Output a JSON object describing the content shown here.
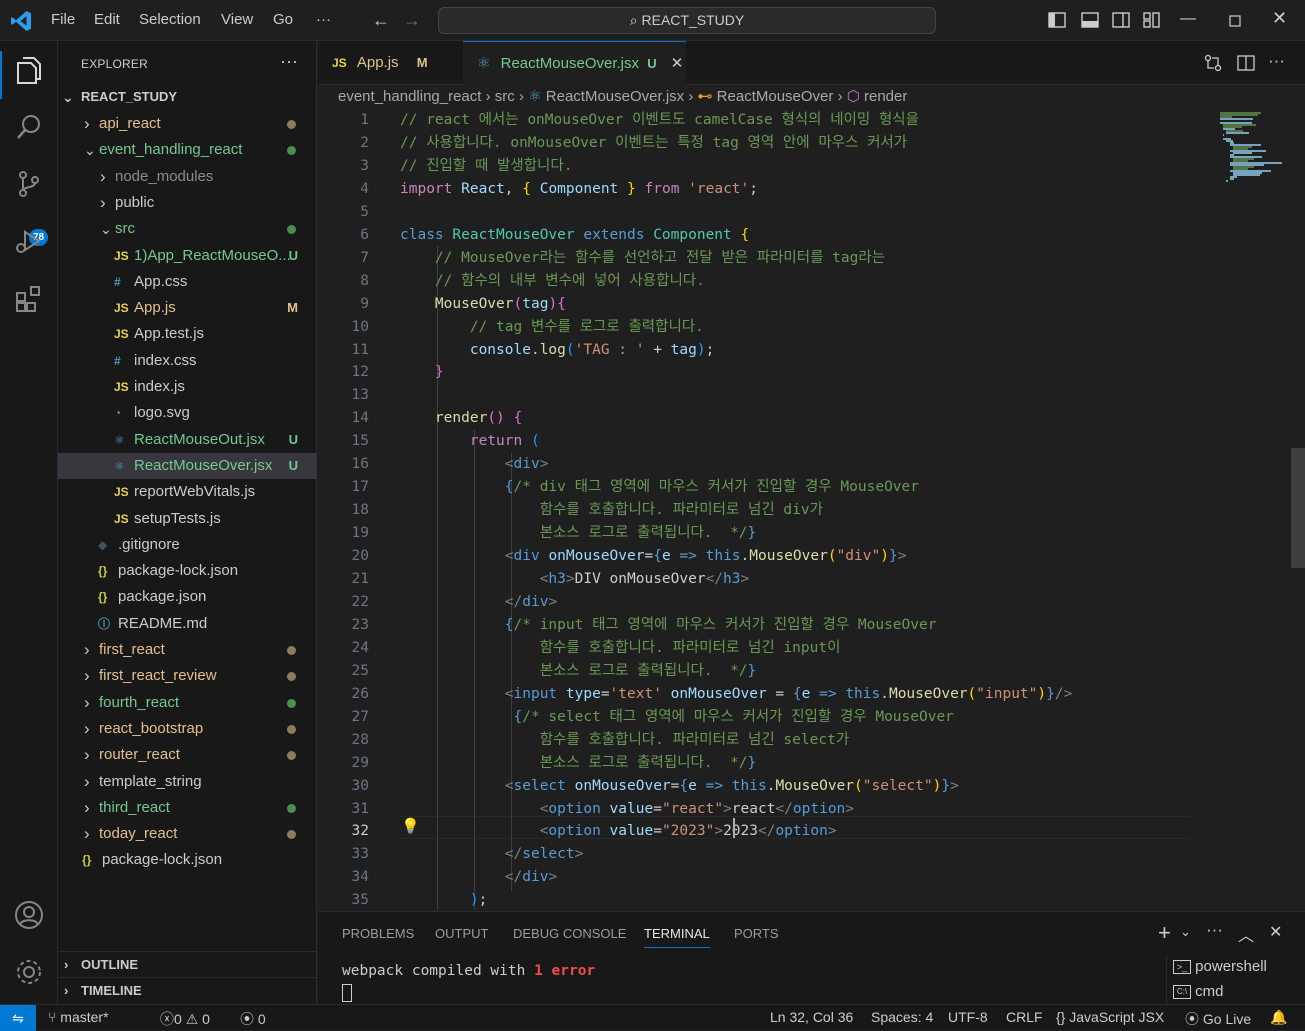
{
  "titlebar": {
    "menus": [
      "File",
      "Edit",
      "Selection",
      "View",
      "Go",
      "···"
    ],
    "search_text": "REACT_STUDY"
  },
  "activity": {
    "source_control_badge": "78"
  },
  "explorer": {
    "title": "EXPLORER",
    "root": "REACT_STUDY",
    "items": [
      {
        "label": "api_react",
        "type": "folder",
        "level": 1,
        "expanded": false,
        "status": "dot",
        "status_color": "#8c7a5a",
        "label_color": "#e2c08d"
      },
      {
        "label": "event_handling_react",
        "type": "folder",
        "level": 1,
        "expanded": true,
        "status": "dot",
        "status_color": "#4a8f4a",
        "label_color": "#73c991"
      },
      {
        "label": "node_modules",
        "type": "folder",
        "level": 2,
        "expanded": false,
        "label_color": "#8b8b8b"
      },
      {
        "label": "public",
        "type": "folder",
        "level": 2,
        "expanded": false,
        "label_color": "#cccccc"
      },
      {
        "label": "src",
        "type": "folder",
        "level": 2,
        "expanded": true,
        "status": "dot",
        "status_color": "#4a8f4a",
        "label_color": "#73c991"
      },
      {
        "label": "1)App_ReactMouseO...",
        "type": "js",
        "level": 3,
        "status": "U",
        "label_color": "#73c991"
      },
      {
        "label": "App.css",
        "type": "css",
        "level": 3,
        "label_color": "#cccccc"
      },
      {
        "label": "App.js",
        "type": "js",
        "level": 3,
        "status": "M",
        "label_color": "#e2c08d"
      },
      {
        "label": "App.test.js",
        "type": "js",
        "level": 3,
        "label_color": "#cccccc"
      },
      {
        "label": "index.css",
        "type": "css",
        "level": 3,
        "label_color": "#cccccc"
      },
      {
        "label": "index.js",
        "type": "js",
        "level": 3,
        "label_color": "#cccccc"
      },
      {
        "label": "logo.svg",
        "type": "svg",
        "level": 3,
        "label_color": "#cccccc"
      },
      {
        "label": "ReactMouseOut.jsx",
        "type": "react",
        "level": 3,
        "status": "U",
        "label_color": "#73c991"
      },
      {
        "label": "ReactMouseOver.jsx",
        "type": "react",
        "level": 3,
        "status": "U",
        "label_color": "#73c991",
        "selected": true
      },
      {
        "label": "reportWebVitals.js",
        "type": "js",
        "level": 3,
        "label_color": "#cccccc"
      },
      {
        "label": "setupTests.js",
        "type": "js",
        "level": 3,
        "label_color": "#cccccc"
      },
      {
        "label": ".gitignore",
        "type": "git",
        "level": 2,
        "label_color": "#cccccc"
      },
      {
        "label": "package-lock.json",
        "type": "json",
        "level": 2,
        "label_color": "#cccccc"
      },
      {
        "label": "package.json",
        "type": "json",
        "level": 2,
        "label_color": "#cccccc"
      },
      {
        "label": "README.md",
        "type": "md",
        "level": 2,
        "label_color": "#cccccc"
      },
      {
        "label": "first_react",
        "type": "folder",
        "level": 1,
        "expanded": false,
        "status": "dot",
        "status_color": "#8c7a5a",
        "label_color": "#e2c08d"
      },
      {
        "label": "first_react_review",
        "type": "folder",
        "level": 1,
        "expanded": false,
        "status": "dot",
        "status_color": "#8c7a5a",
        "label_color": "#e2c08d"
      },
      {
        "label": "fourth_react",
        "type": "folder",
        "level": 1,
        "expanded": false,
        "status": "dot",
        "status_color": "#4a8f4a",
        "label_color": "#73c991"
      },
      {
        "label": "react_bootstrap",
        "type": "folder",
        "level": 1,
        "expanded": false,
        "status": "dot",
        "status_color": "#8c7a5a",
        "label_color": "#e2c08d"
      },
      {
        "label": "router_react",
        "type": "folder",
        "level": 1,
        "expanded": false,
        "status": "dot",
        "status_color": "#8c7a5a",
        "label_color": "#e2c08d"
      },
      {
        "label": "template_string",
        "type": "folder",
        "level": 1,
        "expanded": false,
        "label_color": "#cccccc"
      },
      {
        "label": "third_react",
        "type": "folder",
        "level": 1,
        "expanded": false,
        "status": "dot",
        "status_color": "#4a8f4a",
        "label_color": "#73c991"
      },
      {
        "label": "today_react",
        "type": "folder",
        "level": 1,
        "expanded": false,
        "status": "dot",
        "status_color": "#8c7a5a",
        "label_color": "#e2c08d"
      },
      {
        "label": "package-lock.json",
        "type": "json",
        "level": 1,
        "label_color": "#cccccc"
      }
    ],
    "outline": "OUTLINE",
    "timeline": "TIMELINE"
  },
  "tabs": [
    {
      "icon": "JS",
      "label": "App.js",
      "status": "M",
      "active": false
    },
    {
      "icon": "react",
      "label": "ReactMouseOver.jsx",
      "status": "U",
      "active": true
    }
  ],
  "breadcrumbs": [
    "event_handling_react",
    "src",
    "ReactMouseOver.jsx",
    "ReactMouseOver",
    "render"
  ],
  "editor": {
    "current_line": 32,
    "lines": [
      [
        [
          "// react 에서는 onMouseOver 이벤트도 camelCase 형식의 네이밍 형식을",
          "c-com"
        ]
      ],
      [
        [
          "// 사용합니다. onMouseOver 이벤트는 특정 tag 영역 안에 마우스 커서가",
          "c-com"
        ]
      ],
      [
        [
          "// 진입할 때 발생합니다.",
          "c-com"
        ]
      ],
      [
        [
          "import",
          "c-kw"
        ],
        [
          " ",
          ""
        ],
        [
          "React",
          "c-var"
        ],
        [
          ", ",
          ""
        ],
        [
          "{",
          "c-y"
        ],
        [
          " ",
          ""
        ],
        [
          "Component",
          "c-var"
        ],
        [
          " ",
          ""
        ],
        [
          "}",
          "c-y"
        ],
        [
          " ",
          ""
        ],
        [
          "from",
          "c-kw"
        ],
        [
          " ",
          ""
        ],
        [
          "'react'",
          "c-str"
        ],
        [
          ";",
          ""
        ]
      ],
      [],
      [
        [
          "class",
          "c-bl"
        ],
        [
          " ",
          ""
        ],
        [
          "ReactMouseOver",
          "c-tp"
        ],
        [
          " ",
          ""
        ],
        [
          "extends",
          "c-bl"
        ],
        [
          " ",
          ""
        ],
        [
          "Component",
          "c-tp"
        ],
        [
          " ",
          ""
        ],
        [
          "{",
          "c-y"
        ]
      ],
      [
        [
          "    ",
          ""
        ],
        [
          "// MouseOver라는 함수를 선언하고 전달 받은 파라미터를 tag라는",
          "c-com"
        ]
      ],
      [
        [
          "    ",
          ""
        ],
        [
          "// 함수의 내부 변수에 넣어 사용합니다.",
          "c-com"
        ]
      ],
      [
        [
          "    ",
          ""
        ],
        [
          "MouseOver",
          "c-fn"
        ],
        [
          "(",
          "c-p"
        ],
        [
          "tag",
          "c-var"
        ],
        [
          ")",
          "c-p"
        ],
        [
          "{",
          "c-p"
        ]
      ],
      [
        [
          "        ",
          ""
        ],
        [
          "// tag 변수를 로그로 출력합니다.",
          "c-com"
        ]
      ],
      [
        [
          "        ",
          ""
        ],
        [
          "console",
          "c-var"
        ],
        [
          ".",
          ""
        ],
        [
          "log",
          "c-fn"
        ],
        [
          "(",
          "c-b"
        ],
        [
          "'TAG : '",
          "c-str"
        ],
        [
          " + ",
          ""
        ],
        [
          "tag",
          "c-var"
        ],
        [
          ")",
          "c-b"
        ],
        [
          ";",
          ""
        ]
      ],
      [
        [
          "    ",
          ""
        ],
        [
          "}",
          "c-p"
        ]
      ],
      [],
      [
        [
          "    ",
          ""
        ],
        [
          "render",
          "c-fn"
        ],
        [
          "(",
          "c-p"
        ],
        [
          ")",
          "c-p"
        ],
        [
          " ",
          ""
        ],
        [
          "{",
          "c-p"
        ]
      ],
      [
        [
          "        ",
          ""
        ],
        [
          "return",
          "c-kw"
        ],
        [
          " ",
          ""
        ],
        [
          "(",
          "c-b"
        ]
      ],
      [
        [
          "            ",
          ""
        ],
        [
          "<",
          "c-brk"
        ],
        [
          "div",
          "c-tag"
        ],
        [
          ">",
          "c-brk"
        ]
      ],
      [
        [
          "            ",
          ""
        ],
        [
          "{",
          "c-bl"
        ],
        [
          "/* div 태그 영역에 마우스 커서가 진입할 경우 MouseOver",
          "c-com"
        ]
      ],
      [
        [
          "                ",
          ""
        ],
        [
          "함수를 호출합니다. 파라미터로 넘긴 div가",
          "c-com"
        ]
      ],
      [
        [
          "                ",
          ""
        ],
        [
          "본소스 로그로 출력됩니다.  */",
          "c-com"
        ],
        [
          "}",
          "c-bl"
        ]
      ],
      [
        [
          "            ",
          ""
        ],
        [
          "<",
          "c-brk"
        ],
        [
          "div",
          "c-tag"
        ],
        [
          " ",
          ""
        ],
        [
          "onMouseOver",
          "c-var"
        ],
        [
          "=",
          ""
        ],
        [
          "{",
          "c-bl"
        ],
        [
          "e",
          "c-var"
        ],
        [
          " ",
          ""
        ],
        [
          "=>",
          "c-bl"
        ],
        [
          " ",
          ""
        ],
        [
          "this",
          "c-bl"
        ],
        [
          ".",
          ""
        ],
        [
          "MouseOver",
          "c-fn"
        ],
        [
          "(",
          "c-y"
        ],
        [
          "\"div\"",
          "c-str"
        ],
        [
          ")",
          "c-y"
        ],
        [
          "}",
          "c-bl"
        ],
        [
          ">",
          "c-brk"
        ]
      ],
      [
        [
          "                ",
          ""
        ],
        [
          "<",
          "c-brk"
        ],
        [
          "h3",
          "c-tag"
        ],
        [
          ">",
          "c-brk"
        ],
        [
          "DIV onMouseOver",
          ""
        ],
        [
          "</",
          "c-brk"
        ],
        [
          "h3",
          "c-tag"
        ],
        [
          ">",
          "c-brk"
        ]
      ],
      [
        [
          "            ",
          ""
        ],
        [
          "</",
          "c-brk"
        ],
        [
          "div",
          "c-tag"
        ],
        [
          ">",
          "c-brk"
        ]
      ],
      [
        [
          "            ",
          ""
        ],
        [
          "{",
          "c-bl"
        ],
        [
          "/* input 태그 영역에 마우스 커서가 진입할 경우 MouseOver",
          "c-com"
        ]
      ],
      [
        [
          "                ",
          ""
        ],
        [
          "함수를 호출합니다. 파라미터로 넘긴 input이",
          "c-com"
        ]
      ],
      [
        [
          "                ",
          ""
        ],
        [
          "본소스 로그로 출력됩니다.  */",
          "c-com"
        ],
        [
          "}",
          "c-bl"
        ]
      ],
      [
        [
          "            ",
          ""
        ],
        [
          "<",
          "c-brk"
        ],
        [
          "input",
          "c-tag"
        ],
        [
          " ",
          ""
        ],
        [
          "type",
          "c-var"
        ],
        [
          "=",
          ""
        ],
        [
          "'text'",
          "c-str"
        ],
        [
          " ",
          ""
        ],
        [
          "onMouseOver",
          "c-var"
        ],
        [
          " = ",
          ""
        ],
        [
          "{",
          "c-bl"
        ],
        [
          "e",
          "c-var"
        ],
        [
          " ",
          ""
        ],
        [
          "=>",
          "c-bl"
        ],
        [
          " ",
          ""
        ],
        [
          "this",
          "c-bl"
        ],
        [
          ".",
          ""
        ],
        [
          "MouseOver",
          "c-fn"
        ],
        [
          "(",
          "c-y"
        ],
        [
          "\"input\"",
          "c-str"
        ],
        [
          ")",
          "c-y"
        ],
        [
          "}",
          "c-bl"
        ],
        [
          "/>",
          "c-brk"
        ]
      ],
      [
        [
          "             ",
          ""
        ],
        [
          "{",
          "c-bl"
        ],
        [
          "/* select 태그 영역에 마우스 커서가 진입할 경우 MouseOver",
          "c-com"
        ]
      ],
      [
        [
          "                ",
          ""
        ],
        [
          "함수를 호출합니다. 파라미터로 넘긴 select가",
          "c-com"
        ]
      ],
      [
        [
          "                ",
          ""
        ],
        [
          "본소스 로그로 출력됩니다.  */",
          "c-com"
        ],
        [
          "}",
          "c-bl"
        ]
      ],
      [
        [
          "            ",
          ""
        ],
        [
          "<",
          "c-brk"
        ],
        [
          "select",
          "c-tag"
        ],
        [
          " ",
          ""
        ],
        [
          "onMouseOver",
          "c-var"
        ],
        [
          "=",
          ""
        ],
        [
          "{",
          "c-bl"
        ],
        [
          "e",
          "c-var"
        ],
        [
          " ",
          ""
        ],
        [
          "=>",
          "c-bl"
        ],
        [
          " ",
          ""
        ],
        [
          "this",
          "c-bl"
        ],
        [
          ".",
          ""
        ],
        [
          "MouseOver",
          "c-fn"
        ],
        [
          "(",
          "c-y"
        ],
        [
          "\"select\"",
          "c-str"
        ],
        [
          ")",
          "c-y"
        ],
        [
          "}",
          "c-bl"
        ],
        [
          ">",
          "c-brk"
        ]
      ],
      [
        [
          "                ",
          ""
        ],
        [
          "<",
          "c-brk"
        ],
        [
          "option",
          "c-tag"
        ],
        [
          " ",
          ""
        ],
        [
          "value",
          "c-var"
        ],
        [
          "=",
          ""
        ],
        [
          "\"react\"",
          "c-str"
        ],
        [
          ">",
          "c-brk"
        ],
        [
          "react",
          ""
        ],
        [
          "</",
          "c-brk"
        ],
        [
          "option",
          "c-tag"
        ],
        [
          ">",
          "c-brk"
        ]
      ],
      [
        [
          "                ",
          ""
        ],
        [
          "<",
          "c-brk"
        ],
        [
          "option",
          "c-tag"
        ],
        [
          " ",
          ""
        ],
        [
          "value",
          "c-var"
        ],
        [
          "=",
          ""
        ],
        [
          "\"2023\"",
          "c-str"
        ],
        [
          ">",
          "c-brk"
        ],
        [
          "2023",
          ""
        ],
        [
          "</",
          "c-brk"
        ],
        [
          "option",
          "c-tag"
        ],
        [
          ">",
          "c-brk"
        ]
      ],
      [
        [
          "            ",
          ""
        ],
        [
          "</",
          "c-brk"
        ],
        [
          "select",
          "c-tag"
        ],
        [
          ">",
          "c-brk"
        ]
      ],
      [
        [
          "            ",
          ""
        ],
        [
          "</",
          "c-brk"
        ],
        [
          "div",
          "c-tag"
        ],
        [
          ">",
          "c-brk"
        ]
      ],
      [
        [
          "        ",
          ""
        ],
        [
          ")",
          "c-b"
        ],
        [
          ";",
          ""
        ]
      ]
    ]
  },
  "panel": {
    "tabs": [
      "PROBLEMS",
      "OUTPUT",
      "DEBUG CONSOLE",
      "TERMINAL",
      "PORTS"
    ],
    "active_tab": "TERMINAL",
    "terminal_prefix": "webpack compiled with ",
    "terminal_error": "1 error",
    "terminals": [
      "powershell",
      "cmd"
    ]
  },
  "statusbar": {
    "branch": "master*",
    "errors": "0",
    "warnings": "0",
    "ports": "0",
    "position": "Ln 32, Col 36",
    "spaces": "Spaces: 4",
    "encoding": "UTF-8",
    "eol": "CRLF",
    "language": "JavaScript JSX",
    "golive": "Go Live"
  },
  "colors": {
    "accent": "#0078d4",
    "modified": "#e2c08d",
    "untracked": "#73c991",
    "error": "#f14c4c"
  }
}
